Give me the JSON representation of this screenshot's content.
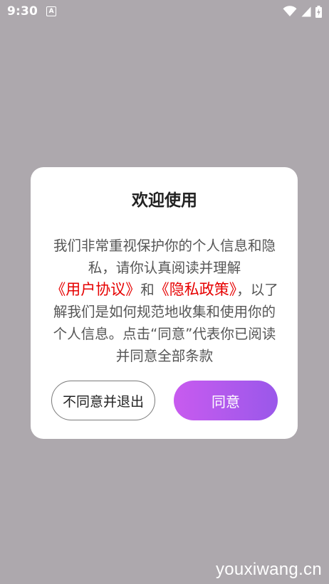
{
  "status_bar": {
    "time": "9:30",
    "notification_icon": "a-letter-icon",
    "wifi_icon": "wifi-icon",
    "signal_icon": "cell-signal-icon",
    "battery_icon": "battery-charging-icon"
  },
  "dialog": {
    "title": "欢迎使用",
    "body": {
      "part1": "我们非常重视保护你的个人信息和隐私，请你认真阅读并理解",
      "link_user_agreement": "《用户协议》",
      "part2": "和",
      "link_privacy_policy": "《隐私政策》",
      "part3": "，以了解我们是如何规范地收集和使用你的个人信息。点击“同意”代表你已阅读并同意全部条款"
    },
    "decline_label": "不同意并退出",
    "agree_label": "同意"
  },
  "colors": {
    "overlay": "#ada8ad",
    "link": "#e60000",
    "agree_gradient_start": "#c85bef",
    "agree_gradient_end": "#9a58ea"
  },
  "watermark": "youxiwang.cn"
}
